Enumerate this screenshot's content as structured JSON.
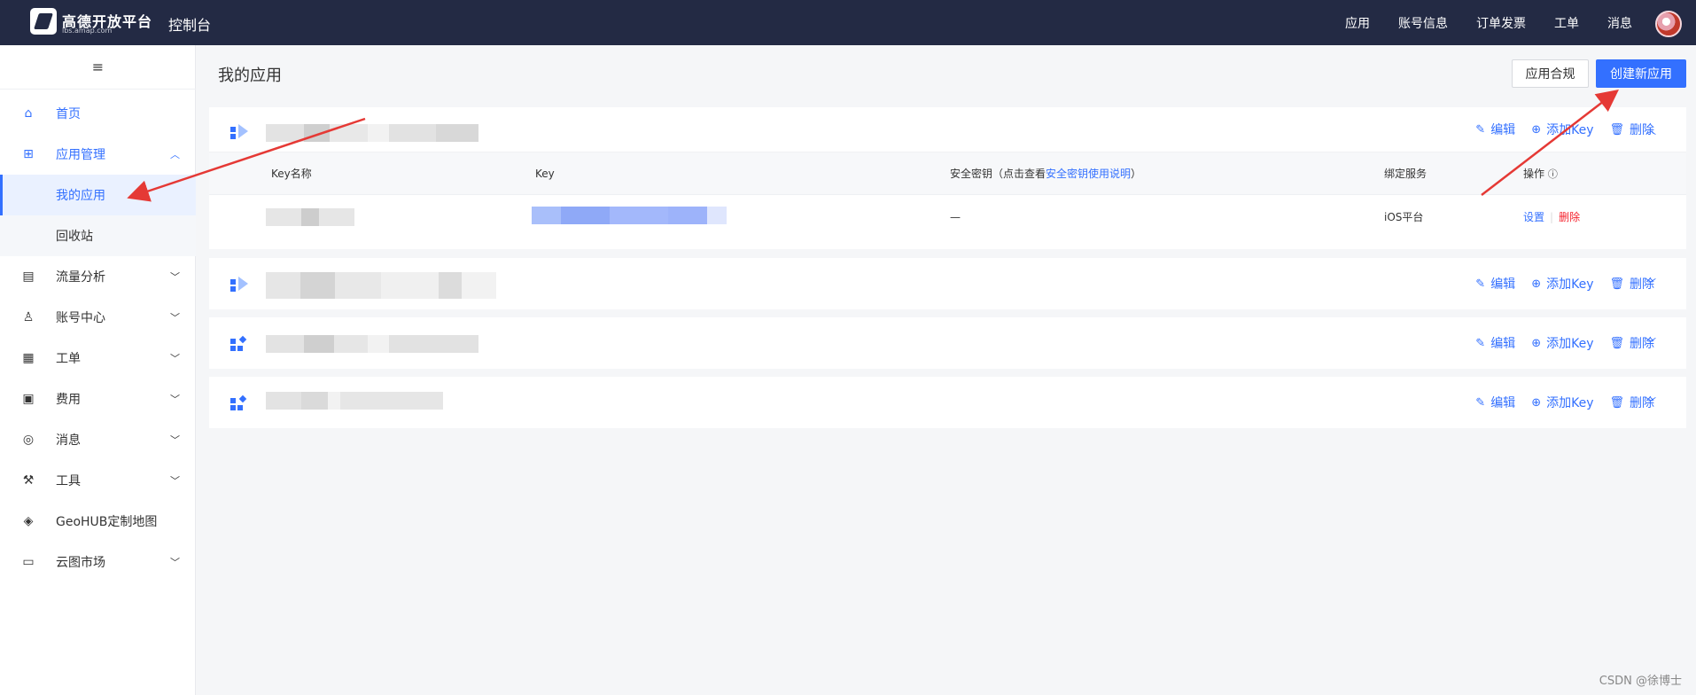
{
  "topbar": {
    "logo_text": "高德开放平台",
    "logo_sub": "lbs.amap.com",
    "console": "控制台",
    "nav": [
      "应用",
      "账号信息",
      "订单发票",
      "工单",
      "消息"
    ]
  },
  "sidebar": {
    "collapse_icon": "≡",
    "items": [
      {
        "label": "首页",
        "icon": "home-icon",
        "glyph": "⌂"
      },
      {
        "label": "应用管理",
        "icon": "grid-icon",
        "glyph": "⊞",
        "expanded": true
      },
      {
        "label": "流量分析",
        "icon": "chart-icon",
        "glyph": "▤"
      },
      {
        "label": "账号中心",
        "icon": "user-icon",
        "glyph": "♙"
      },
      {
        "label": "工单",
        "icon": "ticket-icon",
        "glyph": "▦"
      },
      {
        "label": "费用",
        "icon": "fee-icon",
        "glyph": "▣"
      },
      {
        "label": "消息",
        "icon": "message-icon",
        "glyph": "◎"
      },
      {
        "label": "工具",
        "icon": "wrench-icon",
        "glyph": "⚒"
      },
      {
        "label": "GeoHUB定制地图",
        "icon": "layers-icon",
        "glyph": "◈"
      },
      {
        "label": "云图市场",
        "icon": "store-icon",
        "glyph": "▭"
      }
    ],
    "subitems": [
      "我的应用",
      "回收站"
    ]
  },
  "main": {
    "title": "我的应用",
    "btn_compliance": "应用合规",
    "btn_create": "创建新应用",
    "actions": {
      "edit": "编辑",
      "add_key": "添加Key",
      "delete": "删除"
    },
    "table": {
      "headers": [
        "Key名称",
        "Key",
        "安全密钥（点击查看",
        "安全密钥使用说明",
        "）",
        "绑定服务",
        "操作"
      ],
      "row": {
        "secret": "—",
        "service": "iOS平台",
        "settings": "设置",
        "delete": "删除"
      }
    }
  },
  "watermark": "CSDN @徐博士",
  "colors": {
    "accent": "#3370ff",
    "topbar": "#232a44",
    "danger": "#f5222d",
    "annotation": "#e53935"
  }
}
